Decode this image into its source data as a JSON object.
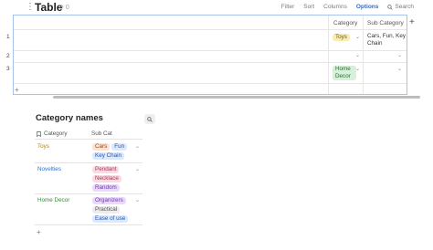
{
  "top_table": {
    "title": "Table",
    "view_count": "0",
    "toolbar": {
      "filter": "Filter",
      "sort": "Sort",
      "columns": "Columns",
      "options": "Options",
      "search": "Search"
    },
    "columns": [
      "Category",
      "Sub Category"
    ],
    "rows": [
      {
        "num": "1",
        "category": "Toys",
        "sub_category": "Cars, Fun, Key Chain"
      },
      {
        "num": "2",
        "category": "",
        "sub_category": ""
      },
      {
        "num": "3",
        "category": "Home Decor",
        "sub_category": ""
      }
    ],
    "add_row": "+",
    "add_column": "+"
  },
  "categories_table": {
    "title": "Category names",
    "headers": {
      "category": "Category",
      "sub_cat": "Sub Cat"
    },
    "rows": [
      {
        "name": "Toys",
        "subs": [
          "Cars",
          "Fun",
          "Key Chain"
        ]
      },
      {
        "name": "Novelties",
        "subs": [
          "Pendant",
          "Necklace",
          "Random"
        ]
      },
      {
        "name": "Home Decor",
        "subs": [
          "Organizers",
          "Practical",
          "Ease of use"
        ]
      }
    ],
    "add_row": "+"
  },
  "colors": {
    "accent": "#2a6bd6",
    "toys": "#b08a00",
    "novelties": "#2f6fcf",
    "home_decor": "#3b8a3e",
    "selection_border": "#a7c3ee"
  },
  "icons": [
    "drag-handle-icon",
    "link-icon",
    "search-icon",
    "bookmark-icon",
    "chevron-down-icon",
    "plus-icon"
  ]
}
